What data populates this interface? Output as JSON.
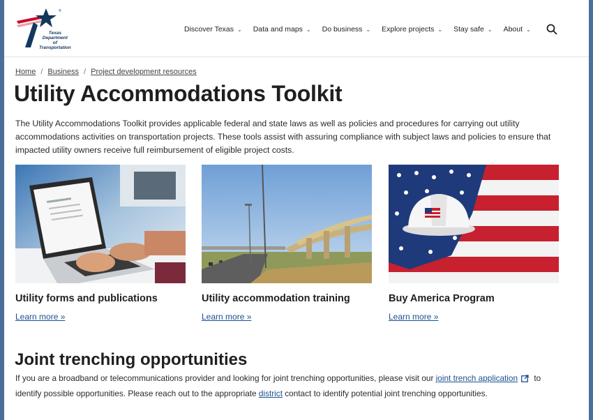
{
  "header": {
    "logo_alt": "Texas Department of Transportation",
    "logo_lines": [
      "Texas",
      "Department",
      "of Transportation"
    ],
    "nav": [
      {
        "label": "Discover Texas"
      },
      {
        "label": "Data and maps"
      },
      {
        "label": "Do business"
      },
      {
        "label": "Explore projects"
      },
      {
        "label": "Stay safe"
      },
      {
        "label": "About"
      }
    ],
    "search_icon": "search-icon"
  },
  "breadcrumb": {
    "items": [
      "Home",
      "Business",
      "Project development resources"
    ],
    "separator": "/"
  },
  "page": {
    "title": "Utility Accommodations Toolkit",
    "intro": "The Utility Accommodations Toolkit provides applicable federal and state laws as well as policies and procedures for carrying out utility accommodations activities on transportation projects. These tools assist with assuring compliance with subject laws and policies to ensure that impacted utility owners receive full reimbursement of eligible project costs."
  },
  "cards": [
    {
      "title": "Utility forms and publications",
      "link": "Learn more  »"
    },
    {
      "title": "Utility accommodation training",
      "link": "Learn more  »"
    },
    {
      "title": "Buy America Program",
      "link": "Learn more  »"
    }
  ],
  "joint": {
    "title": "Joint trenching opportunities",
    "text_1": "If you are a broadband or telecommunications provider and looking for joint trenching opportunities, please visit our ",
    "link_1": "joint trench application",
    "text_2": " to identify possible opportunities. Please reach out to the appropriate ",
    "link_2": "district",
    "text_3": " contact to identify potential joint trenching opportunities."
  },
  "colors": {
    "link": "#1a4f8f",
    "logo_blue": "#14375e",
    "logo_red": "#c8102e",
    "frame_bg": "#4a6f9a"
  }
}
